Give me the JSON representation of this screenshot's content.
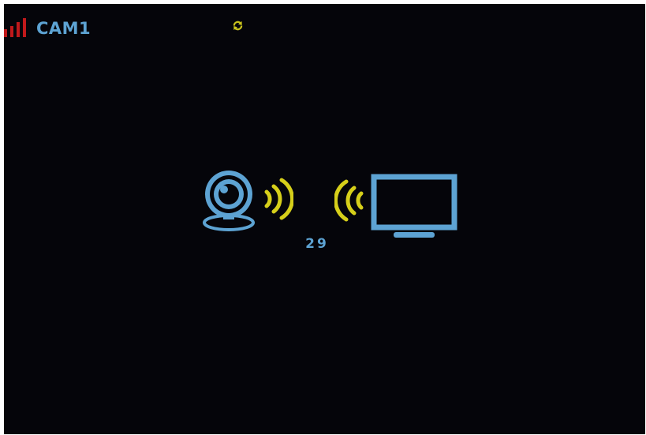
{
  "status_bar": {
    "camera_label": "CAM1",
    "signal_level": 4,
    "signal_color": "#c0191b",
    "sync_icon": "sync-arrows-icon",
    "sync_color": "#c8c21d"
  },
  "pairing": {
    "countdown": "29",
    "camera_icon": "webcam-icon",
    "monitor_icon": "monitor-icon",
    "wave_color": "#d6cf1a",
    "icon_color": "#5da3d3"
  },
  "screen": {
    "background": "#05050a"
  }
}
